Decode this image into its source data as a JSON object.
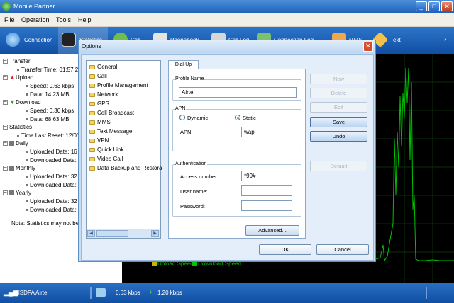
{
  "window": {
    "title": "Mobile Partner"
  },
  "menu": [
    {
      "label": "File"
    },
    {
      "label": "Operation"
    },
    {
      "label": "Tools"
    },
    {
      "label": "Help"
    }
  ],
  "toolbar": [
    {
      "label": "Connection",
      "icon": "connection-icon"
    },
    {
      "label": "Statistics",
      "icon": "statistics-icon"
    },
    {
      "label": "Call",
      "icon": "call-icon"
    },
    {
      "label": "Phonebook",
      "icon": "phonebook-icon"
    },
    {
      "label": "Call Log",
      "icon": "call-log-icon"
    },
    {
      "label": "Connection Log",
      "icon": "connection-log-icon"
    },
    {
      "label": "MMS",
      "icon": "mms-icon"
    },
    {
      "label": "Text",
      "icon": "text-icon"
    }
  ],
  "stats": {
    "transfer": "Transfer",
    "transfer_time": "Transfer Time: 01:57:2",
    "upload": "Upload",
    "upload_speed": "Speed: 0.63 kbps",
    "upload_data": "Data: 14.23 MB",
    "download": "Download",
    "download_speed": "Speed: 0.30 kbps",
    "download_data": "Data: 68.63 MB",
    "statistics": "Statistics",
    "time_last_reset": "Time Last Reset: 12/01",
    "daily": "Daily",
    "daily_up": "Uploaded Data: 16",
    "daily_down": "Downloaded Data:",
    "monthly": "Monthly",
    "monthly_up": "Uploaded Data: 32",
    "monthly_down": "Downloaded Data:",
    "yearly": "Yearly",
    "yearly_up": "Uploaded Data: 32",
    "yearly_down": "Downloaded Data:",
    "note": "Note: Statistics may not be"
  },
  "graph": {
    "legend_upload": "Upload Speed",
    "legend_download": "Download Speed",
    "color": "#00c000"
  },
  "dialog": {
    "title": "Options",
    "categories": [
      "General",
      "Call",
      "Profile Management",
      "Network",
      "GPS",
      "Cell Broadcast",
      "MMS",
      "Text Message",
      "VPN",
      "Quick Link",
      "Video Call",
      "Data Backup and Restora"
    ],
    "tab": "Dial-Up",
    "profile_name_label": "Profile Name",
    "profile_name_value": "Airtel",
    "apn_group": "APN",
    "dynamic_label": "Dynamic",
    "static_label": "Static",
    "apn_label": "APN:",
    "apn_value": "wap",
    "auth_group": "Authentication",
    "access_number_label": "Access number:",
    "access_number_value": "*99#",
    "user_name_label": "User name:",
    "user_name_value": "",
    "password_label": "Password:",
    "password_value": "",
    "advanced": "Advanced...",
    "new": "New",
    "delete": "Delete",
    "edit": "Edit",
    "save": "Save",
    "undo": "Undo",
    "default": "Default",
    "ok": "OK",
    "cancel": "Cancel"
  },
  "status": {
    "network": "HSDPA",
    "operator": "Airtel",
    "upload_speed": "0.63 kbps",
    "download_speed": "1.20 kbps"
  }
}
